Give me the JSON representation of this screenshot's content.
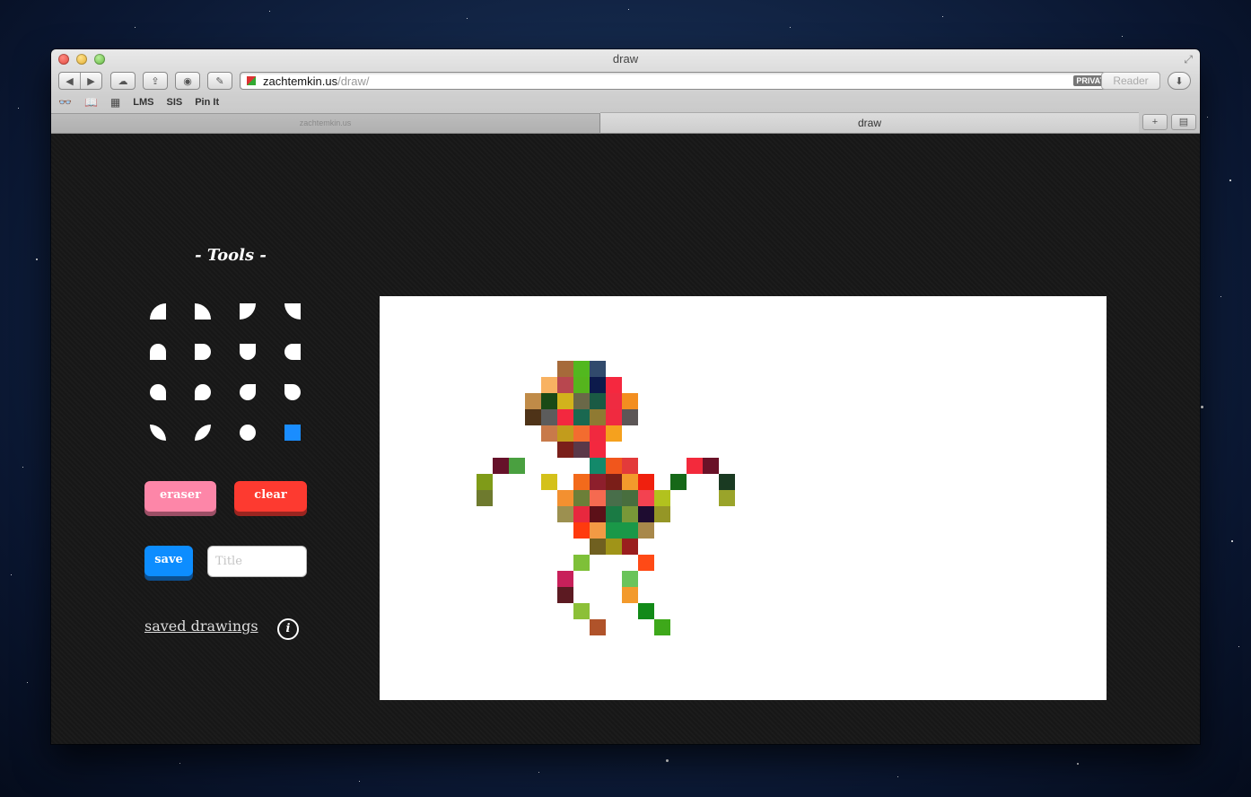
{
  "window": {
    "title": "draw",
    "url_host": "zachtemkin.us",
    "url_path": "/draw/",
    "private_badge": "PRIVATE",
    "reader_label": "Reader"
  },
  "bookmarks": [
    "LMS",
    "SIS",
    "Pin It"
  ],
  "tabs": [
    {
      "label": "zachtemkin.us",
      "active": false
    },
    {
      "label": "draw",
      "active": true
    }
  ],
  "tools": {
    "title": "- Tools -",
    "shapes": [
      "quarter-top-right-round",
      "quarter-top-left-round",
      "quarter-bottom-left-round",
      "quarter-bottom-right-round",
      "half-top-round",
      "half-right-round",
      "half-bottom-round",
      "half-left-round",
      "three-round-no-br",
      "three-round-no-bl",
      "three-round-no-tr",
      "three-round-no-tl",
      "leaf-diagonal-a",
      "leaf-diagonal-b",
      "circle",
      "square"
    ],
    "selected_color": "#1a8dff",
    "eraser_label": "eraser",
    "clear_label": "clear",
    "save_label": "save",
    "title_placeholder": "Title",
    "saved_drawings_label": "saved drawings",
    "info_label": "i"
  },
  "canvas": {
    "cell_size": 18,
    "pixels": [
      [
        11,
        4,
        "#a66a3a"
      ],
      [
        12,
        4,
        "#52b81f"
      ],
      [
        13,
        4,
        "#314a6c"
      ],
      [
        10,
        5,
        "#f8b262"
      ],
      [
        11,
        5,
        "#b8474f"
      ],
      [
        12,
        5,
        "#55b51d"
      ],
      [
        13,
        5,
        "#0c1a4b"
      ],
      [
        14,
        5,
        "#f5283f"
      ],
      [
        9,
        6,
        "#c08b48"
      ],
      [
        10,
        6,
        "#1a4a16"
      ],
      [
        11,
        6,
        "#d2b21c"
      ],
      [
        12,
        6,
        "#6a6848"
      ],
      [
        13,
        6,
        "#1a5a44"
      ],
      [
        14,
        6,
        "#ef2b41"
      ],
      [
        15,
        6,
        "#f38e20"
      ],
      [
        9,
        7,
        "#4e3318"
      ],
      [
        10,
        7,
        "#5c5c5c"
      ],
      [
        11,
        7,
        "#f3283f"
      ],
      [
        12,
        7,
        "#1a6850"
      ],
      [
        13,
        7,
        "#8f7a32"
      ],
      [
        14,
        7,
        "#f02a40"
      ],
      [
        15,
        7,
        "#5c5656"
      ],
      [
        10,
        8,
        "#c87a4a"
      ],
      [
        11,
        8,
        "#c29c1c"
      ],
      [
        12,
        8,
        "#f36c2f"
      ],
      [
        13,
        8,
        "#f1293f"
      ],
      [
        14,
        8,
        "#f5a11e"
      ],
      [
        11,
        9,
        "#7a1f1a"
      ],
      [
        12,
        9,
        "#5a3848"
      ],
      [
        13,
        9,
        "#f3283f"
      ],
      [
        7,
        10,
        "#66122a"
      ],
      [
        8,
        10,
        "#4aa040"
      ],
      [
        13,
        10,
        "#13896a"
      ],
      [
        14,
        10,
        "#f1561c"
      ],
      [
        15,
        10,
        "#e33a3a"
      ],
      [
        19,
        10,
        "#f32a3c"
      ],
      [
        20,
        10,
        "#6a1228"
      ],
      [
        6,
        11,
        "#7f9b18"
      ],
      [
        10,
        11,
        "#d4c11a"
      ],
      [
        12,
        11,
        "#f36a1b"
      ],
      [
        13,
        11,
        "#8d1f2c"
      ],
      [
        14,
        11,
        "#7a1e18"
      ],
      [
        15,
        11,
        "#f39a2c"
      ],
      [
        16,
        11,
        "#f0200e"
      ],
      [
        18,
        11,
        "#166818"
      ],
      [
        21,
        11,
        "#1a3a22"
      ],
      [
        6,
        12,
        "#6e7a2e"
      ],
      [
        11,
        12,
        "#f39030"
      ],
      [
        12,
        12,
        "#6c7f38"
      ],
      [
        13,
        12,
        "#f56a50"
      ],
      [
        14,
        12,
        "#486e4a"
      ],
      [
        15,
        12,
        "#486e3e"
      ],
      [
        16,
        12,
        "#f34250"
      ],
      [
        17,
        12,
        "#b2c21e"
      ],
      [
        21,
        12,
        "#9aa42a"
      ],
      [
        11,
        13,
        "#9c9050"
      ],
      [
        12,
        13,
        "#e8283e"
      ],
      [
        13,
        13,
        "#5c1018"
      ],
      [
        14,
        13,
        "#1a7a44"
      ],
      [
        15,
        13,
        "#789838"
      ],
      [
        16,
        13,
        "#1e0c30"
      ],
      [
        17,
        13,
        "#959626"
      ],
      [
        12,
        14,
        "#ff3a0e"
      ],
      [
        13,
        14,
        "#f29a44"
      ],
      [
        14,
        14,
        "#1a9848"
      ],
      [
        15,
        14,
        "#1a9848"
      ],
      [
        16,
        14,
        "#a8884a"
      ],
      [
        13,
        15,
        "#706020"
      ],
      [
        14,
        15,
        "#a09418"
      ],
      [
        15,
        15,
        "#9a1e1e"
      ],
      [
        12,
        16,
        "#7ec038"
      ],
      [
        16,
        16,
        "#ff4a16"
      ],
      [
        11,
        17,
        "#c8205a"
      ],
      [
        15,
        17,
        "#6ac45a"
      ],
      [
        11,
        18,
        "#5c1a22"
      ],
      [
        15,
        18,
        "#f39a2c"
      ],
      [
        12,
        19,
        "#8cc038"
      ],
      [
        16,
        19,
        "#128a18"
      ],
      [
        13,
        20,
        "#b0532a"
      ],
      [
        17,
        20,
        "#3ea81a"
      ]
    ]
  }
}
